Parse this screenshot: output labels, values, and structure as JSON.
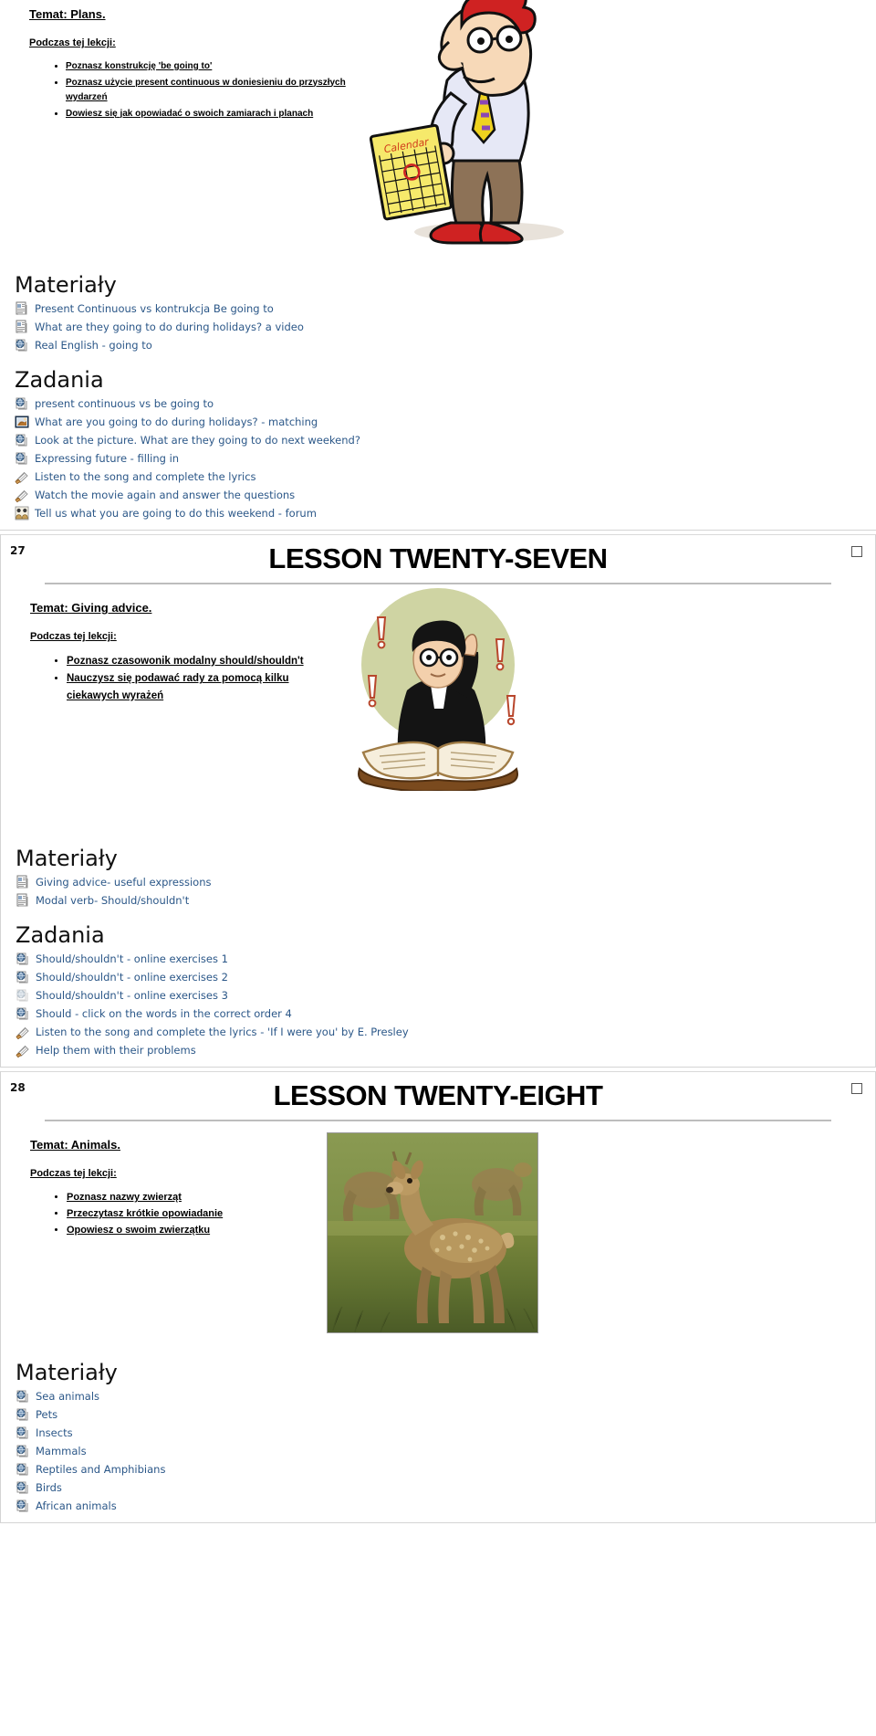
{
  "colors": {
    "link": "#2B5788",
    "rule": "#bdbdbd",
    "section_border": "#d4d4d4"
  },
  "labels": {
    "materials_heading": "Materiały",
    "tasks_heading": "Zadania",
    "objectives_heading": "Podczas tej lekcji:"
  },
  "sections": [
    {
      "number": "",
      "title": "",
      "topic": "Temat: Plans.",
      "objectives_heading": "Podczas tej lekcji:",
      "objectives": [
        "Poznasz konstrukcję 'be going to'",
        "Poznasz użycie present continuous w doniesieniu do przyszłych wydarzeń",
        "Dowiesz się jak opowiadać o swoich zamiarach i planach"
      ],
      "illustration": "cartoon-man-with-calendar",
      "materials_heading": "Materiały",
      "materials": [
        {
          "icon": "document-icon",
          "label": "Present Continuous vs kontrukcja Be going to"
        },
        {
          "icon": "document-icon",
          "label": "What are they going to do during holidays? a video"
        },
        {
          "icon": "url-globe-icon",
          "label": "Real English - going to"
        }
      ],
      "tasks_heading": "Zadania",
      "tasks": [
        {
          "icon": "url-globe-icon",
          "label": "present continuous vs be going to"
        },
        {
          "icon": "hotpot-icon",
          "label": "What are you going to do during holidays? - matching"
        },
        {
          "icon": "url-globe-icon",
          "label": "Look at the picture. What are they going to do next weekend?"
        },
        {
          "icon": "url-globe-icon",
          "label": "Expressing future - filling in"
        },
        {
          "icon": "assignment-icon",
          "label": "Listen to the song and complete the lyrics"
        },
        {
          "icon": "assignment-icon",
          "label": "Watch the movie again and answer the questions"
        },
        {
          "icon": "forum-icon",
          "label": "Tell us what you are going to do this weekend - forum"
        }
      ]
    },
    {
      "number": "27",
      "title": "LESSON TWENTY-SEVEN",
      "topic": "Temat: Giving advice.",
      "objectives_heading": "Podczas tej lekcji:",
      "objectives": [
        "Poznasz czasowonik modalny should/shouldn't",
        "Nauczysz się podawać rady za pomocą kilku ciekawych wyrażeń"
      ],
      "illustration": "advisor-on-book",
      "materials_heading": "Materiały",
      "materials": [
        {
          "icon": "document-icon",
          "label": "Giving advice- useful expressions"
        },
        {
          "icon": "document-icon",
          "label": "Modal verb- Should/shouldn't"
        }
      ],
      "tasks_heading": "Zadania",
      "tasks": [
        {
          "icon": "url-globe-icon",
          "label": "Should/shouldn't - online exercises 1"
        },
        {
          "icon": "url-globe-icon",
          "label": "Should/shouldn't - online exercises 2"
        },
        {
          "icon": "url-globe-faded-icon",
          "label": "Should/shouldn't - online exercises 3"
        },
        {
          "icon": "url-globe-icon",
          "label": "Should - click on the words in the correct order 4"
        },
        {
          "icon": "assignment-icon",
          "label": "Listen to the song and complete the lyrics - 'If I were you' by E. Presley"
        },
        {
          "icon": "assignment-icon",
          "label": "Help them with their problems"
        }
      ]
    },
    {
      "number": "28",
      "title": "LESSON TWENTY-EIGHT",
      "topic": "Temat: Animals.",
      "objectives_heading": "Podczas tej lekcji:",
      "objectives": [
        "Poznasz nazwy zwierząt",
        "Przeczytasz krótkie opowiadanie",
        "Opowiesz o swoim zwierzątku"
      ],
      "illustration": "deer-photo",
      "materials_heading": "Materiały",
      "materials": [
        {
          "icon": "url-globe-icon",
          "label": "Sea animals"
        },
        {
          "icon": "url-globe-icon",
          "label": "Pets"
        },
        {
          "icon": "url-globe-icon",
          "label": "Insects"
        },
        {
          "icon": "url-globe-icon",
          "label": "Mammals"
        },
        {
          "icon": "url-globe-icon",
          "label": "Reptiles and Amphibians"
        },
        {
          "icon": "url-globe-icon",
          "label": "Birds"
        },
        {
          "icon": "url-globe-icon",
          "label": "African animals"
        }
      ],
      "tasks_heading": null,
      "tasks": []
    }
  ]
}
